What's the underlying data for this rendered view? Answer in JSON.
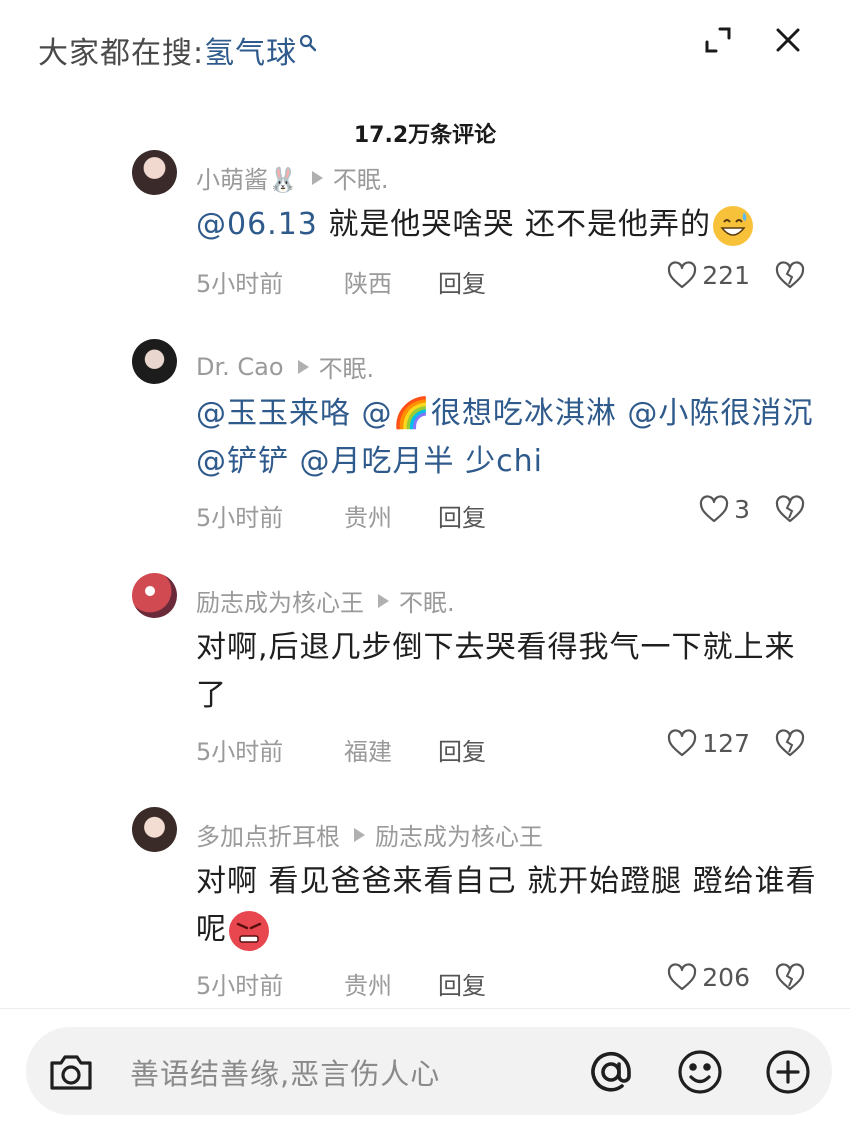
{
  "header": {
    "search_prefix": "大家都在搜:",
    "search_keyword": "氢气球",
    "icons": {
      "search": "search-icon",
      "expand": "expand-icon",
      "close": "close-icon"
    }
  },
  "comment_count": "17.2万条评论",
  "comments": [
    {
      "author": "小萌酱🐰",
      "reply_to": "不眠.",
      "content_parts": [
        "@06.13",
        " 就是他哭啥哭 还不是他弄的"
      ],
      "emoji": "grinning-sweat-emoji",
      "time": "5小时前",
      "location": "陕西",
      "reply_label": "回复",
      "likes": "221"
    },
    {
      "author": "Dr. Cao",
      "reply_to": "不眠.",
      "content_parts": [
        "@玉玉来咯 @🌈很想吃冰淇淋 @小陈很消沉 @铲铲 @月吃月半",
        " 少chi"
      ],
      "time": "5小时前",
      "location": "贵州",
      "reply_label": "回复",
      "likes": "3"
    },
    {
      "author": "励志成为核心王",
      "reply_to": "不眠.",
      "content": "对啊,后退几步倒下去哭看得我气一下就上来了",
      "time": "5小时前",
      "location": "福建",
      "reply_label": "回复",
      "likes": "127"
    },
    {
      "author": "多加点折耳根",
      "reply_to": "励志成为核心王",
      "content": "对啊 看见爸爸来看自己 就开始蹬腿 蹬给谁看呢",
      "emoji": "angry-face-emoji",
      "time": "5小时前",
      "location": "贵州",
      "reply_label": "回复",
      "likes": "206"
    }
  ],
  "input": {
    "placeholder": "善语结善缘,恶言伤人心",
    "icons": [
      "camera-icon",
      "at-icon",
      "emoji-icon",
      "add-icon"
    ]
  },
  "colors": {
    "mention": "#2f5a8c",
    "meta": "#9a9a9a",
    "input_bg": "#f2f2f2"
  }
}
